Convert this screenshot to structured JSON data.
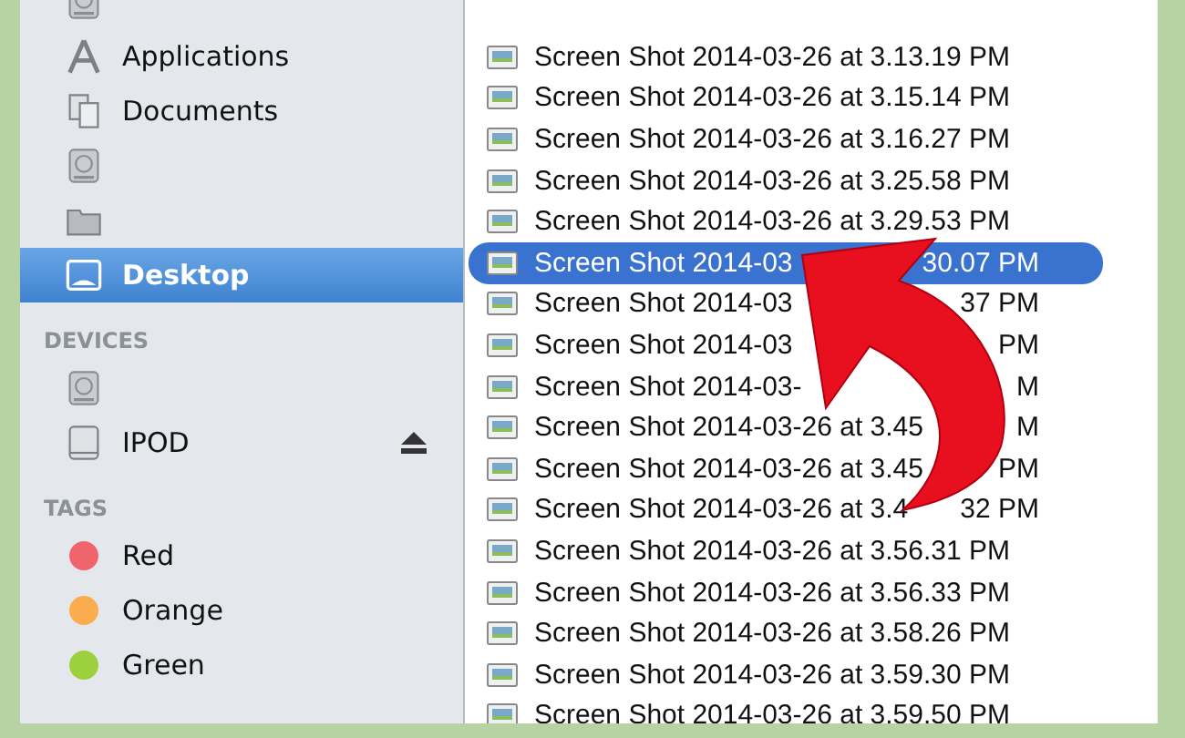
{
  "sidebar": {
    "sections": [
      {
        "items": [
          {
            "kind": "drive",
            "selected": false
          },
          {
            "kind": "applications",
            "label": "Applications",
            "selected": false
          },
          {
            "kind": "documents",
            "label": "Documents",
            "selected": false
          },
          {
            "kind": "drive",
            "selected": false
          },
          {
            "kind": "folder",
            "selected": false
          },
          {
            "kind": "desktop",
            "label": "Desktop",
            "selected": true
          }
        ]
      },
      {
        "header": "DEVICES",
        "items": [
          {
            "kind": "drive",
            "selected": false
          },
          {
            "kind": "ipod",
            "label": "IPOD",
            "eject": true,
            "selected": false
          }
        ]
      },
      {
        "header": "TAGS",
        "items": [
          {
            "kind": "tag",
            "label": "Red",
            "color": "#f0646c",
            "selected": false
          },
          {
            "kind": "tag",
            "label": "Orange",
            "color": "#fbac4c",
            "selected": false
          },
          {
            "kind": "tag",
            "label": "Green",
            "color": "#9cd03c",
            "selected": false
          }
        ]
      }
    ]
  },
  "files": [
    {
      "name": "Screen Shot 2014-03-26 at 3.13.19 PM",
      "selected": false
    },
    {
      "name": "Screen Shot 2014-03-26 at 3.15.14 PM",
      "selected": false
    },
    {
      "name": "Screen Shot 2014-03-26 at 3.16.27 PM",
      "selected": false
    },
    {
      "name": "Screen Shot 2014-03-26 at 3.25.58 PM",
      "selected": false
    },
    {
      "name": "Screen Shot 2014-03-26 at 3.29.53 PM",
      "selected": false
    },
    {
      "name": "Screen Shot 2014-03",
      "tail": "30.07 PM",
      "selected": true
    },
    {
      "name": "Screen Shot 2014-03",
      "tail": "37 PM",
      "selected": false
    },
    {
      "name": "Screen Shot 2014-03",
      "tail": "PM",
      "selected": false
    },
    {
      "name": "Screen Shot 2014-03-",
      "tail": "M",
      "selected": false
    },
    {
      "name": "Screen Shot 2014-03-26 at 3.45",
      "tail": "M",
      "selected": false
    },
    {
      "name": "Screen Shot 2014-03-26 at 3.45",
      "tail": "PM",
      "selected": false
    },
    {
      "name": "Screen Shot 2014-03-26 at 3.4",
      "tail": "32 PM",
      "selected": false
    },
    {
      "name": "Screen Shot 2014-03-26 at 3.56.31 PM",
      "selected": false
    },
    {
      "name": "Screen Shot 2014-03-26 at 3.56.33 PM",
      "selected": false
    },
    {
      "name": "Screen Shot 2014-03-26 at 3.58.26 PM",
      "selected": false
    },
    {
      "name": "Screen Shot 2014-03-26 at 3.59.30 PM",
      "selected": false
    },
    {
      "name": "Screen Shot 2014-03-26 at 3.59.50 PM",
      "selected": false
    }
  ]
}
